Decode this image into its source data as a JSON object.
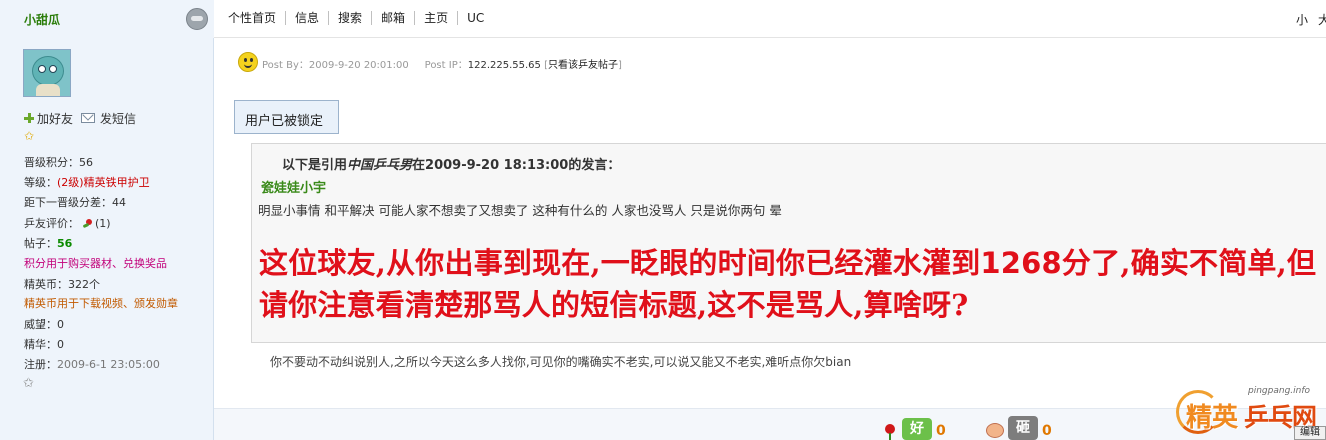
{
  "sidebar": {
    "username": "小甜瓜",
    "add_friend": "加好友",
    "send_message": "发短信",
    "stats": {
      "level_points_label": "晋级积分：",
      "level_points_value": "56",
      "rank_label": "等级：",
      "rank_value": "(2级)精英铁甲护卫",
      "next_level_label": "距下一晋级分差：",
      "next_level_value": "44",
      "rating_label": "乒友评价：",
      "rating_value": "(1)",
      "posts_label": "帖子：",
      "posts_value": "56",
      "points_usage_note": "积分用于购买器材、兑换奖品",
      "coins_label": "精英币：",
      "coins_value": "322个",
      "coins_usage_note": "精英币用于下载视频、颁发勋章",
      "prestige_label": "威望：",
      "prestige_value": "0",
      "essence_label": "精华：",
      "essence_value": "0",
      "registered_label": "注册：",
      "registered_value": "2009-6-1 23:05:00"
    }
  },
  "topnav": {
    "items": [
      "个性首页",
      "信息",
      "搜索",
      "邮箱",
      "主页",
      "UC"
    ],
    "right": [
      "小",
      "大"
    ]
  },
  "post": {
    "post_by_label": "Post By：",
    "post_by_time": "2009-9-20 20:01:00",
    "post_ip_label": "Post IP：",
    "post_ip_value": "122.225.55.65",
    "only_this_user": "只看该乒友帖子",
    "lock_notice": "用户已被锁定",
    "quote_header_prefix": "以下是引用",
    "quote_author": "中国乒乓男",
    "quote_header_suffix": "在2009-9-20 18:13:00的发言：",
    "quote_name": "瓷娃娃小宇",
    "quote_text": "明显小事情  和平解决 可能人家不想卖了又想卖了  这种有什么的  人家也没骂人  只是说你两句  晕",
    "big_red_1": "这位球友,从你出事到现在,一眨眼的时间你已经灌水灌到",
    "big_red_num": "1268",
    "big_red_2": "分了,确实不简单,但请你注意看清楚那骂人的短信标题,这不是骂人,算啥呀?",
    "reply_text": "你不要动不动纠说别人,之所以今天这么多人找你,可见你的嘴确实不老实,可以说又能又不老实,难听点你欠bian"
  },
  "footer": {
    "good_label": "好",
    "good_count": "0",
    "bad_label": "砸",
    "bad_count": "0",
    "edit_label": "编辑"
  },
  "watermark": {
    "url": "pingpang.info",
    "logo_text_1": "精英",
    "logo_text_2": "乒乓网"
  }
}
